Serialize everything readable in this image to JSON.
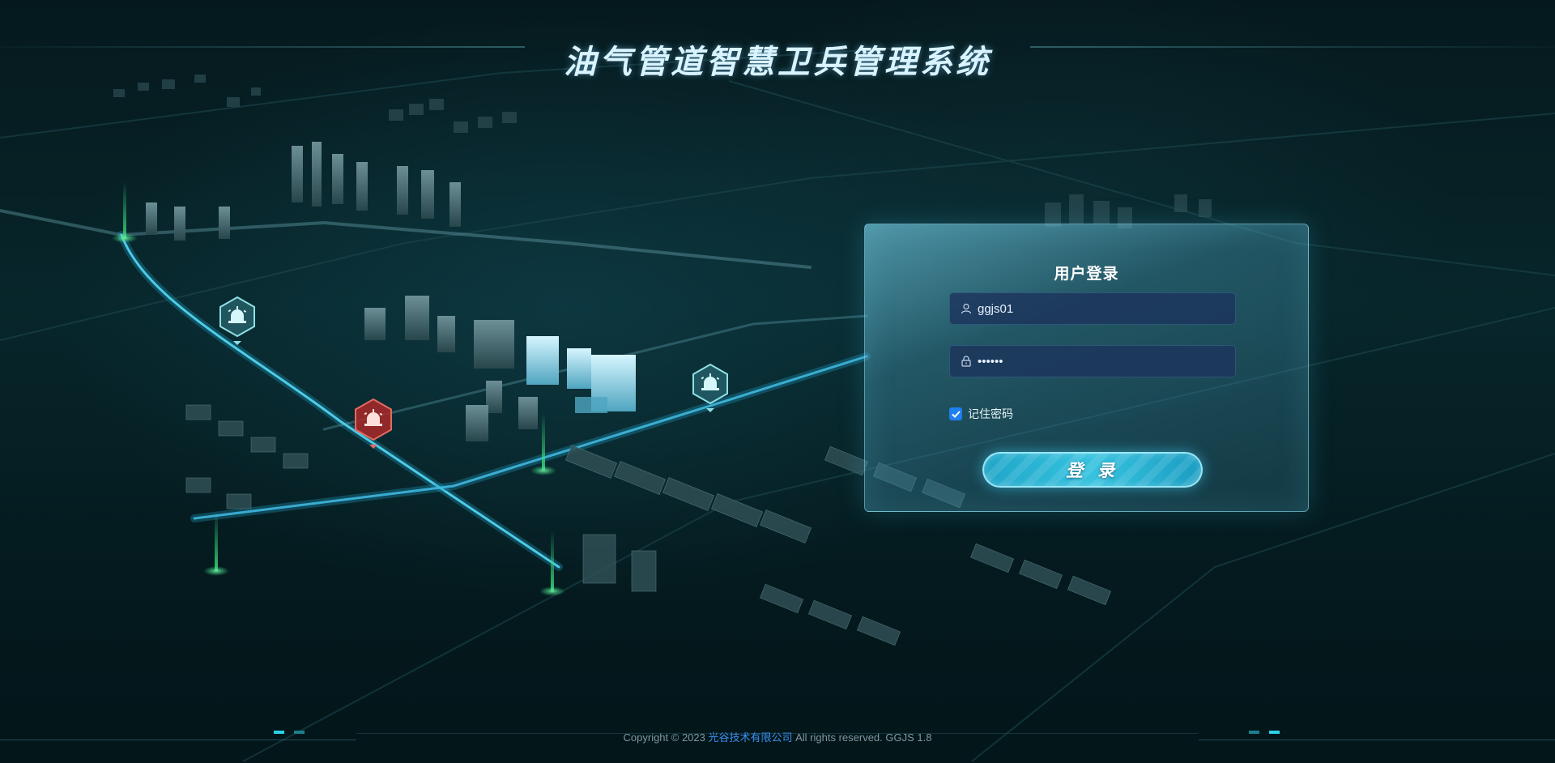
{
  "header": {
    "title": "油气管道智慧卫兵管理系统"
  },
  "map": {
    "alarm_markers": [
      {
        "status": "normal",
        "icon": "alarm-light-icon"
      },
      {
        "status": "alert",
        "icon": "alarm-light-icon"
      },
      {
        "status": "normal",
        "icon": "alarm-light-icon"
      }
    ],
    "colors": {
      "normal_marker": "#8fe0e6",
      "alert_marker": "#d84a45",
      "road_glow": "#2fb6e0",
      "beacon": "#38d97c"
    }
  },
  "login": {
    "title": "用户登录",
    "username": {
      "value": "ggjs01",
      "icon": "user-icon"
    },
    "password": {
      "value": "••••••",
      "icon": "lock-icon"
    },
    "remember": {
      "label": "记住密码",
      "checked": true
    },
    "submit_label": "登 录"
  },
  "footer": {
    "copyright_prefix": "Copyright © 2023 ",
    "company": "光谷技术有限公司",
    "copyright_suffix": " All rights reserved. GGJS 1.8"
  }
}
